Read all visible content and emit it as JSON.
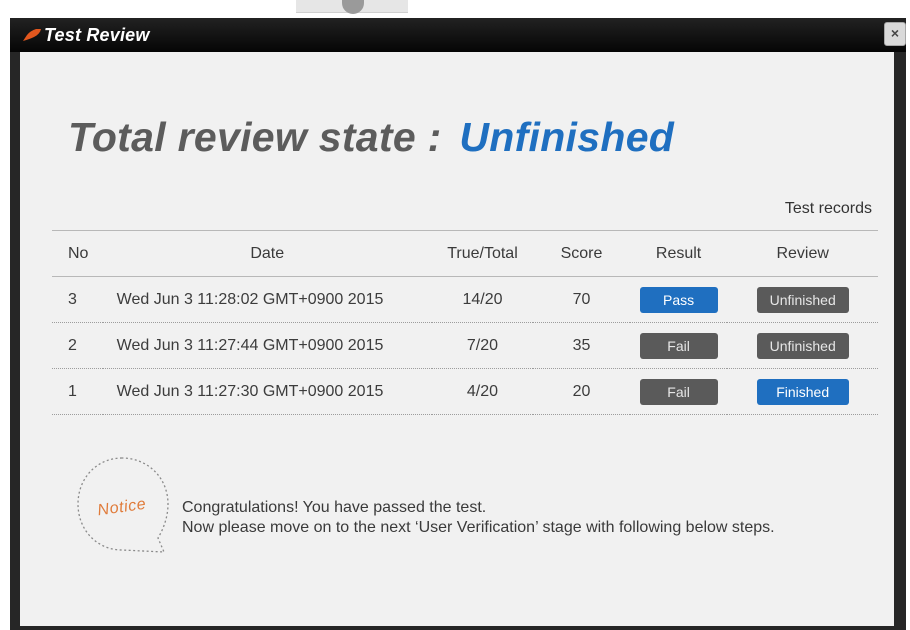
{
  "dialog": {
    "title": "Test Review",
    "close_label": "×"
  },
  "summary": {
    "label": "Total review state :",
    "value": "Unfinished"
  },
  "records": {
    "caption": "Test records",
    "columns": [
      "No",
      "Date",
      "True/Total",
      "Score",
      "Result",
      "Review"
    ],
    "rows": [
      {
        "no": "3",
        "date": "Wed Jun 3 11:28:02 GMT+0900 2015",
        "true_total": "14/20",
        "score": "70",
        "result": "Pass",
        "review": "Unfinished"
      },
      {
        "no": "2",
        "date": "Wed Jun 3 11:27:44 GMT+0900 2015",
        "true_total": "7/20",
        "score": "35",
        "result": "Fail",
        "review": "Unfinished"
      },
      {
        "no": "1",
        "date": "Wed Jun 3 11:27:30 GMT+0900 2015",
        "true_total": "4/20",
        "score": "20",
        "result": "Fail",
        "review": "Finished"
      }
    ]
  },
  "notice": {
    "badge": "Notice",
    "line1": "Congratulations! You have passed the test.",
    "line2": "Now please move on to the next ‘User Verification’ stage with following below steps."
  },
  "colors": {
    "accent_blue": "#1f6fc0",
    "badge_gray": "#5a5a5a",
    "notice_orange": "#e07b3a",
    "title_icon": "#e2571e"
  }
}
